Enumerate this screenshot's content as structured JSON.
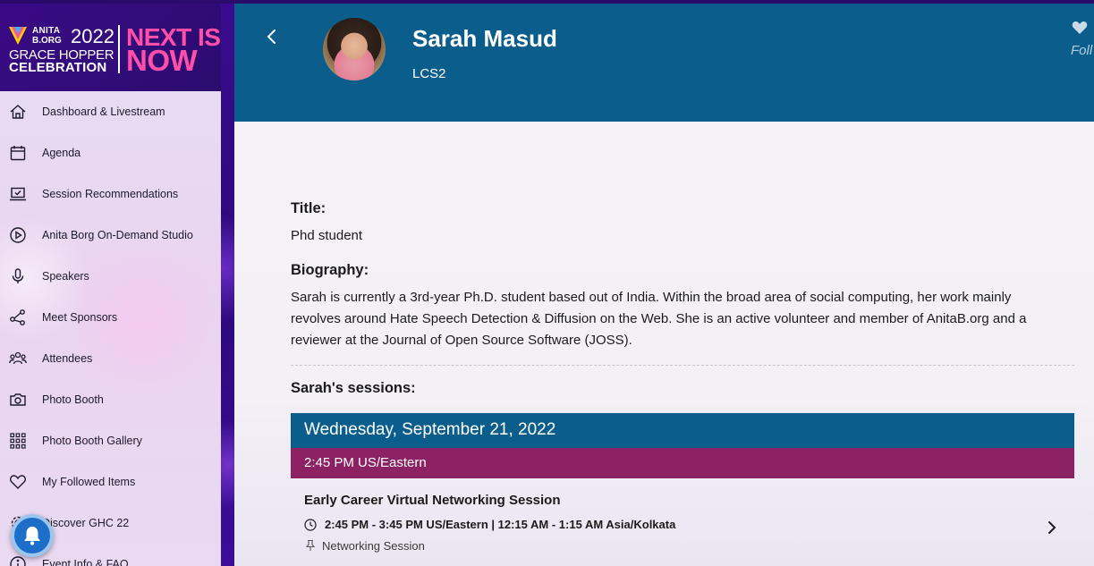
{
  "logo": {
    "anita": "ANITA",
    "borg": "B.ORG",
    "year": "2022",
    "ghc_line1": "GRACE HOPPER",
    "ghc_line2": "CELEBRATION",
    "next_line1": "NEXT IS",
    "next_line2": "NOW"
  },
  "sidebar": {
    "items": [
      {
        "label": "Dashboard & Livestream",
        "icon": "home-icon"
      },
      {
        "label": "Agenda",
        "icon": "calendar-icon"
      },
      {
        "label": "Session Recommendations",
        "icon": "laptop-check-icon"
      },
      {
        "label": "Anita Borg On-Demand Studio",
        "icon": "play-circle-icon"
      },
      {
        "label": "Speakers",
        "icon": "microphone-icon"
      },
      {
        "label": "Meet Sponsors",
        "icon": "share-nodes-icon"
      },
      {
        "label": "Attendees",
        "icon": "people-icon"
      },
      {
        "label": "Photo Booth",
        "icon": "camera-icon"
      },
      {
        "label": "Photo Booth Gallery",
        "icon": "grid-icon"
      },
      {
        "label": "My Followed Items",
        "icon": "heart-icon"
      },
      {
        "label": "Discover GHC 22",
        "icon": "gear-icon"
      },
      {
        "label": "Event Info & FAQ",
        "icon": "info-icon"
      }
    ]
  },
  "header": {
    "name": "Sarah Masud",
    "org": "LCS2",
    "follow_label": "Foll"
  },
  "profile": {
    "title_label": "Title:",
    "title_value": "Phd student",
    "bio_label": "Biography:",
    "bio_lines": [
      "Sarah is currently a 3rd-year Ph.D. student based out of India. Within the broad area of social computing, her work mainly",
      "revolves around Hate Speech Detection & Diffusion on the Web. She is an active volunteer and member of AnitaB.org and a",
      "reviewer at the Journal of Open Source Software (JOSS)."
    ],
    "sessions_label": "Sarah's sessions:"
  },
  "sessions": {
    "date": "Wednesday, September 21, 2022",
    "time_slot": "2:45 PM US/Eastern",
    "items": [
      {
        "title": "Early Career Virtual Networking Session",
        "time": "2:45 PM - 3:45 PM US/Eastern | 12:15 AM - 1:15 AM Asia/Kolkata",
        "type": "Networking Session"
      }
    ]
  },
  "colors": {
    "header_bg": "#0b5e8c",
    "time_bar_bg": "#8c2263",
    "brand_pink": "#ff4fa8",
    "notification_blue": "#1c6ec9"
  }
}
